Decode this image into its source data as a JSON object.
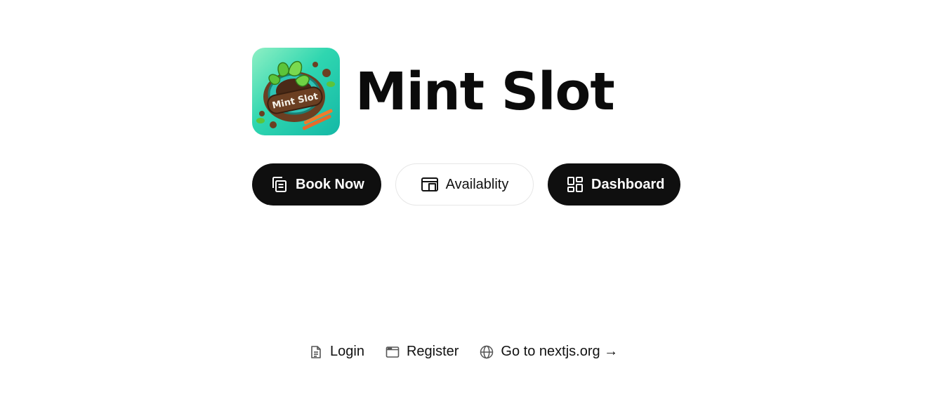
{
  "header": {
    "title": "Mint Slot",
    "logo": {
      "icon": "mint-slot-logo",
      "text": "Mint Slot"
    }
  },
  "actions": {
    "book_now": {
      "label": "Book Now",
      "icon": "copy-icon"
    },
    "availability": {
      "label": "Availablity",
      "icon": "layout-panel-icon"
    },
    "dashboard": {
      "label": "Dashboard",
      "icon": "grid-icon"
    }
  },
  "footer": {
    "login": {
      "label": "Login",
      "icon": "file-icon"
    },
    "register": {
      "label": "Register",
      "icon": "window-icon"
    },
    "nextjs": {
      "label": "Go to nextjs.org →",
      "icon": "globe-icon"
    }
  },
  "colors": {
    "primary_button": "#0f0f0f",
    "logo_gradient_start": "#8ff0c4",
    "logo_gradient_end": "#14b8a6"
  }
}
